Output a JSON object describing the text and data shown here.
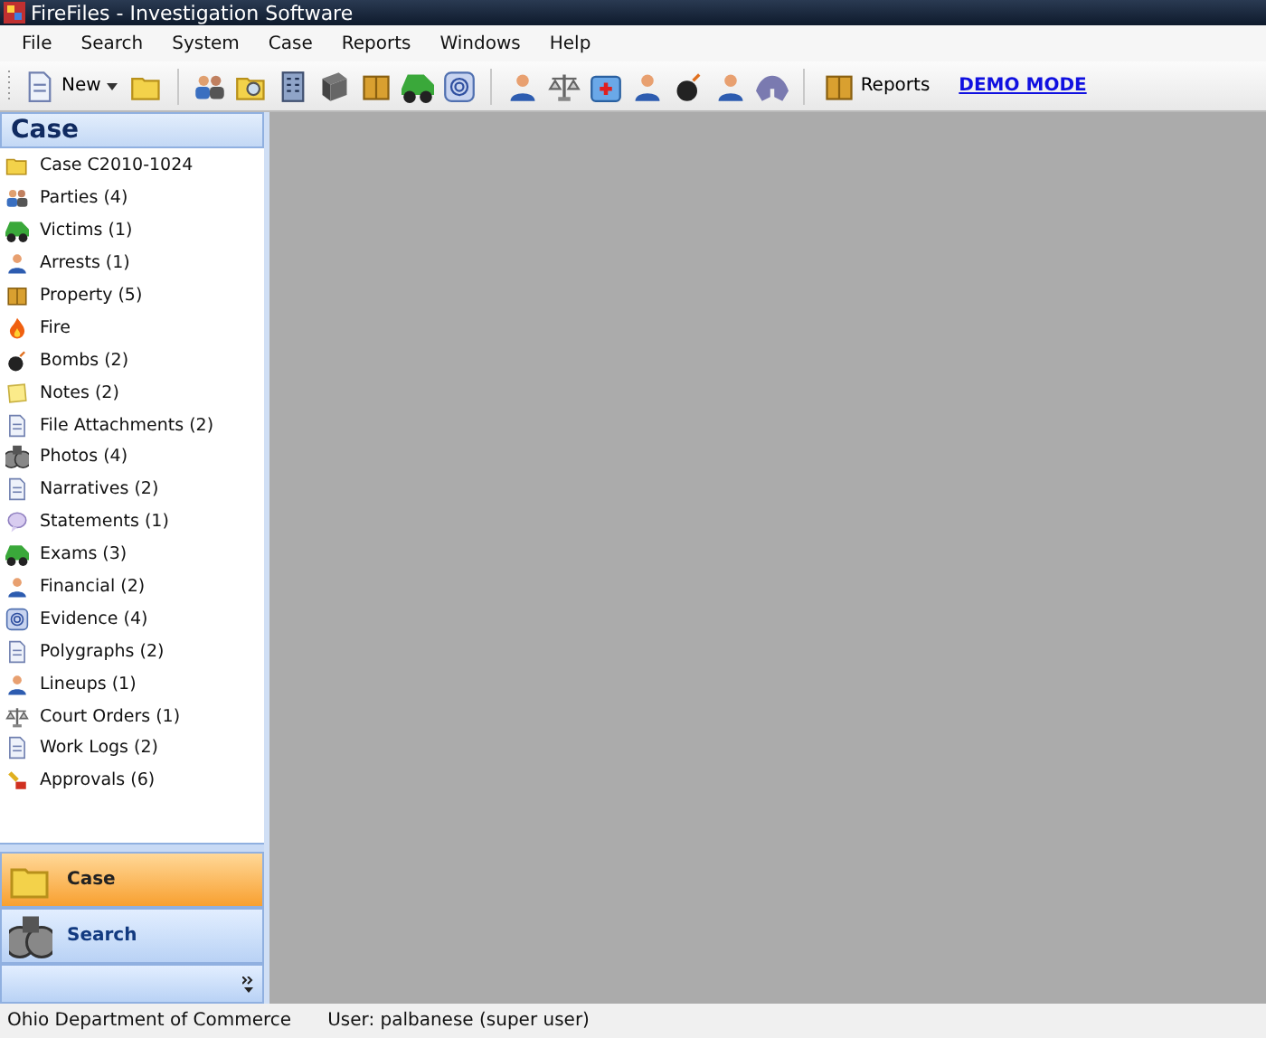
{
  "window": {
    "title": "FireFiles - Investigation Software"
  },
  "menu": [
    "File",
    "Search",
    "System",
    "Case",
    "Reports",
    "Windows",
    "Help"
  ],
  "toolbar": {
    "new_label": "New",
    "reports_label": "Reports",
    "demo_link": "DEMO MODE"
  },
  "sidebar": {
    "header": "Case",
    "items": [
      {
        "label": "Case C2010-1024"
      },
      {
        "label": "Parties (4)"
      },
      {
        "label": "Victims (1)"
      },
      {
        "label": "Arrests (1)"
      },
      {
        "label": "Property (5)"
      },
      {
        "label": "Fire"
      },
      {
        "label": "Bombs (2)"
      },
      {
        "label": "Notes (2)"
      },
      {
        "label": "File Attachments (2)"
      },
      {
        "label": "Photos (4)"
      },
      {
        "label": "Narratives (2)"
      },
      {
        "label": "Statements (1)"
      },
      {
        "label": "Exams (3)"
      },
      {
        "label": "Financial (2)"
      },
      {
        "label": "Evidence (4)"
      },
      {
        "label": "Polygraphs (2)"
      },
      {
        "label": "Lineups (1)"
      },
      {
        "label": "Court Orders (1)"
      },
      {
        "label": "Work Logs (2)"
      },
      {
        "label": "Approvals (6)"
      }
    ],
    "nav_buttons": [
      {
        "label": "Case",
        "selected": true
      },
      {
        "label": "Search",
        "selected": false
      }
    ]
  },
  "status_bar": [
    "Ohio Department of Commerce",
    "User: palbanese (super user)"
  ]
}
